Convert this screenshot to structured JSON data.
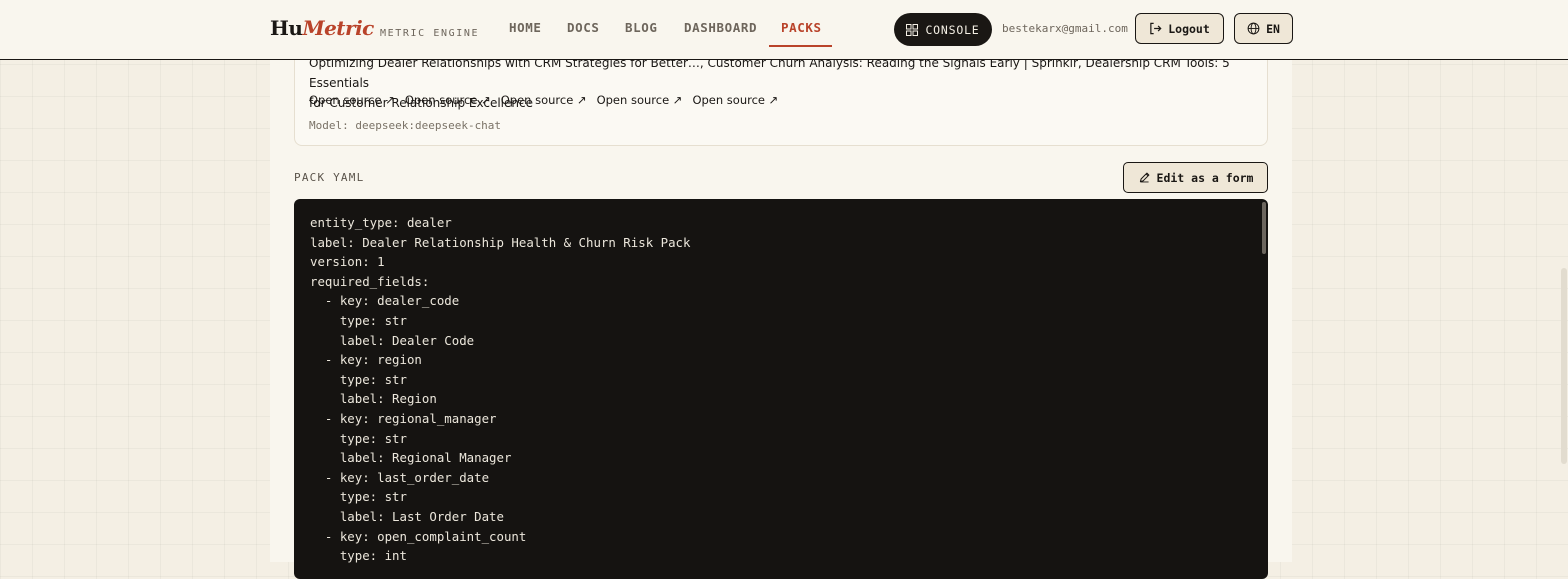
{
  "brand": {
    "name_part1": "Hu",
    "name_part2": "Metric",
    "subtitle": "METRIC ENGINE"
  },
  "nav": {
    "items": [
      {
        "label": "HOME",
        "active": false
      },
      {
        "label": "DOCS",
        "active": false
      },
      {
        "label": "BLOG",
        "active": false
      },
      {
        "label": "DASHBOARD",
        "active": false
      },
      {
        "label": "PACKS",
        "active": true
      }
    ]
  },
  "header": {
    "console_label": "CONSOLE",
    "email": "bestekarx@gmail.com",
    "logout_label": "Logout",
    "lang_label": "EN"
  },
  "sources": {
    "text_line1": "Optimizing Dealer Relationships with CRM Strategies for Better…, Customer Churn Analysis: Reading the Signals Early | Sprinklr, Dealership CRM Tools: 5 Essentials",
    "text_line2": "for Customer Relationship Excellence",
    "links": [
      "Open source",
      "Open source",
      "Open source",
      "Open source",
      "Open source"
    ],
    "model": "Model: deepseek:deepseek-chat"
  },
  "yaml": {
    "title": "PACK YAML",
    "edit_label": "Edit as a form",
    "lines": [
      "entity_type: dealer",
      "label: Dealer Relationship Health & Churn Risk Pack",
      "version: 1",
      "required_fields:",
      "  - key: dealer_code",
      "    type: str",
      "    label: Dealer Code",
      "  - key: region",
      "    type: str",
      "    label: Region",
      "  - key: regional_manager",
      "    type: str",
      "    label: Regional Manager",
      "  - key: last_order_date",
      "    type: str",
      "    label: Last Order Date",
      "  - key: open_complaint_count",
      "    type: int"
    ]
  },
  "colors": {
    "accent": "#b9432a",
    "ink": "#1a1714",
    "code_bg": "#151311",
    "page_bg": "#f4efe4"
  }
}
